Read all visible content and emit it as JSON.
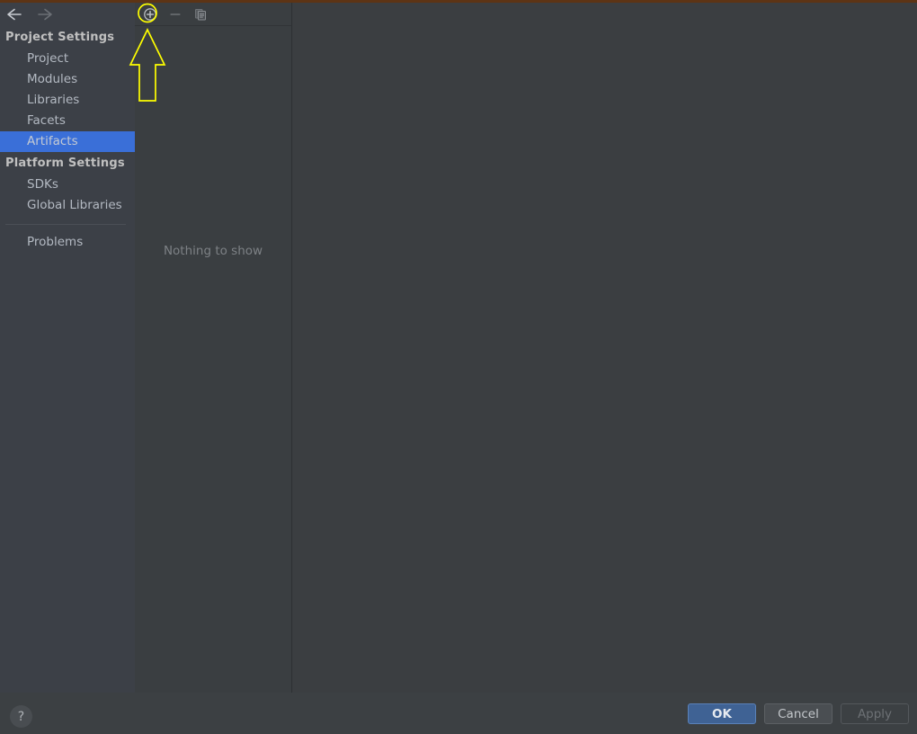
{
  "window": {
    "accent_strip_color": "#5d3415",
    "background_color": "#3b3e41"
  },
  "sidebar": {
    "background_color": "#3c4047",
    "nav": {
      "back_icon": "arrow-left-icon",
      "back_enabled": true,
      "forward_icon": "arrow-right-icon",
      "forward_enabled": false
    },
    "groups": [
      {
        "header": "Project Settings",
        "items": [
          {
            "label": "Project",
            "selected": false
          },
          {
            "label": "Modules",
            "selected": false
          },
          {
            "label": "Libraries",
            "selected": false
          },
          {
            "label": "Facets",
            "selected": false
          },
          {
            "label": "Artifacts",
            "selected": true
          }
        ]
      },
      {
        "header": "Platform Settings",
        "items": [
          {
            "label": "SDKs",
            "selected": false
          },
          {
            "label": "Global Libraries",
            "selected": false
          }
        ]
      }
    ],
    "extra_items": [
      {
        "label": "Problems",
        "selected": false
      }
    ],
    "selection_color": "#3a6fd8"
  },
  "middle_panel": {
    "toolbar": {
      "add": {
        "icon": "plus-circle-icon",
        "tooltip": "Add",
        "highlighted": true
      },
      "remove": {
        "icon": "minus-icon",
        "tooltip": "Remove",
        "enabled": false
      },
      "copy": {
        "icon": "copy-icon",
        "tooltip": "Copy",
        "enabled": false
      }
    },
    "empty_message": "Nothing to show"
  },
  "right_panel": {
    "content": ""
  },
  "footer": {
    "help_label": "?",
    "buttons": [
      {
        "label": "OK",
        "style": "primary"
      },
      {
        "label": "Cancel",
        "style": "normal"
      },
      {
        "label": "Apply",
        "style": "disabled"
      }
    ]
  },
  "annotation": {
    "color": "#ffff00",
    "shapes": [
      "circle-highlight-on-add-button",
      "up-arrow-pointing-to-add-button"
    ]
  }
}
